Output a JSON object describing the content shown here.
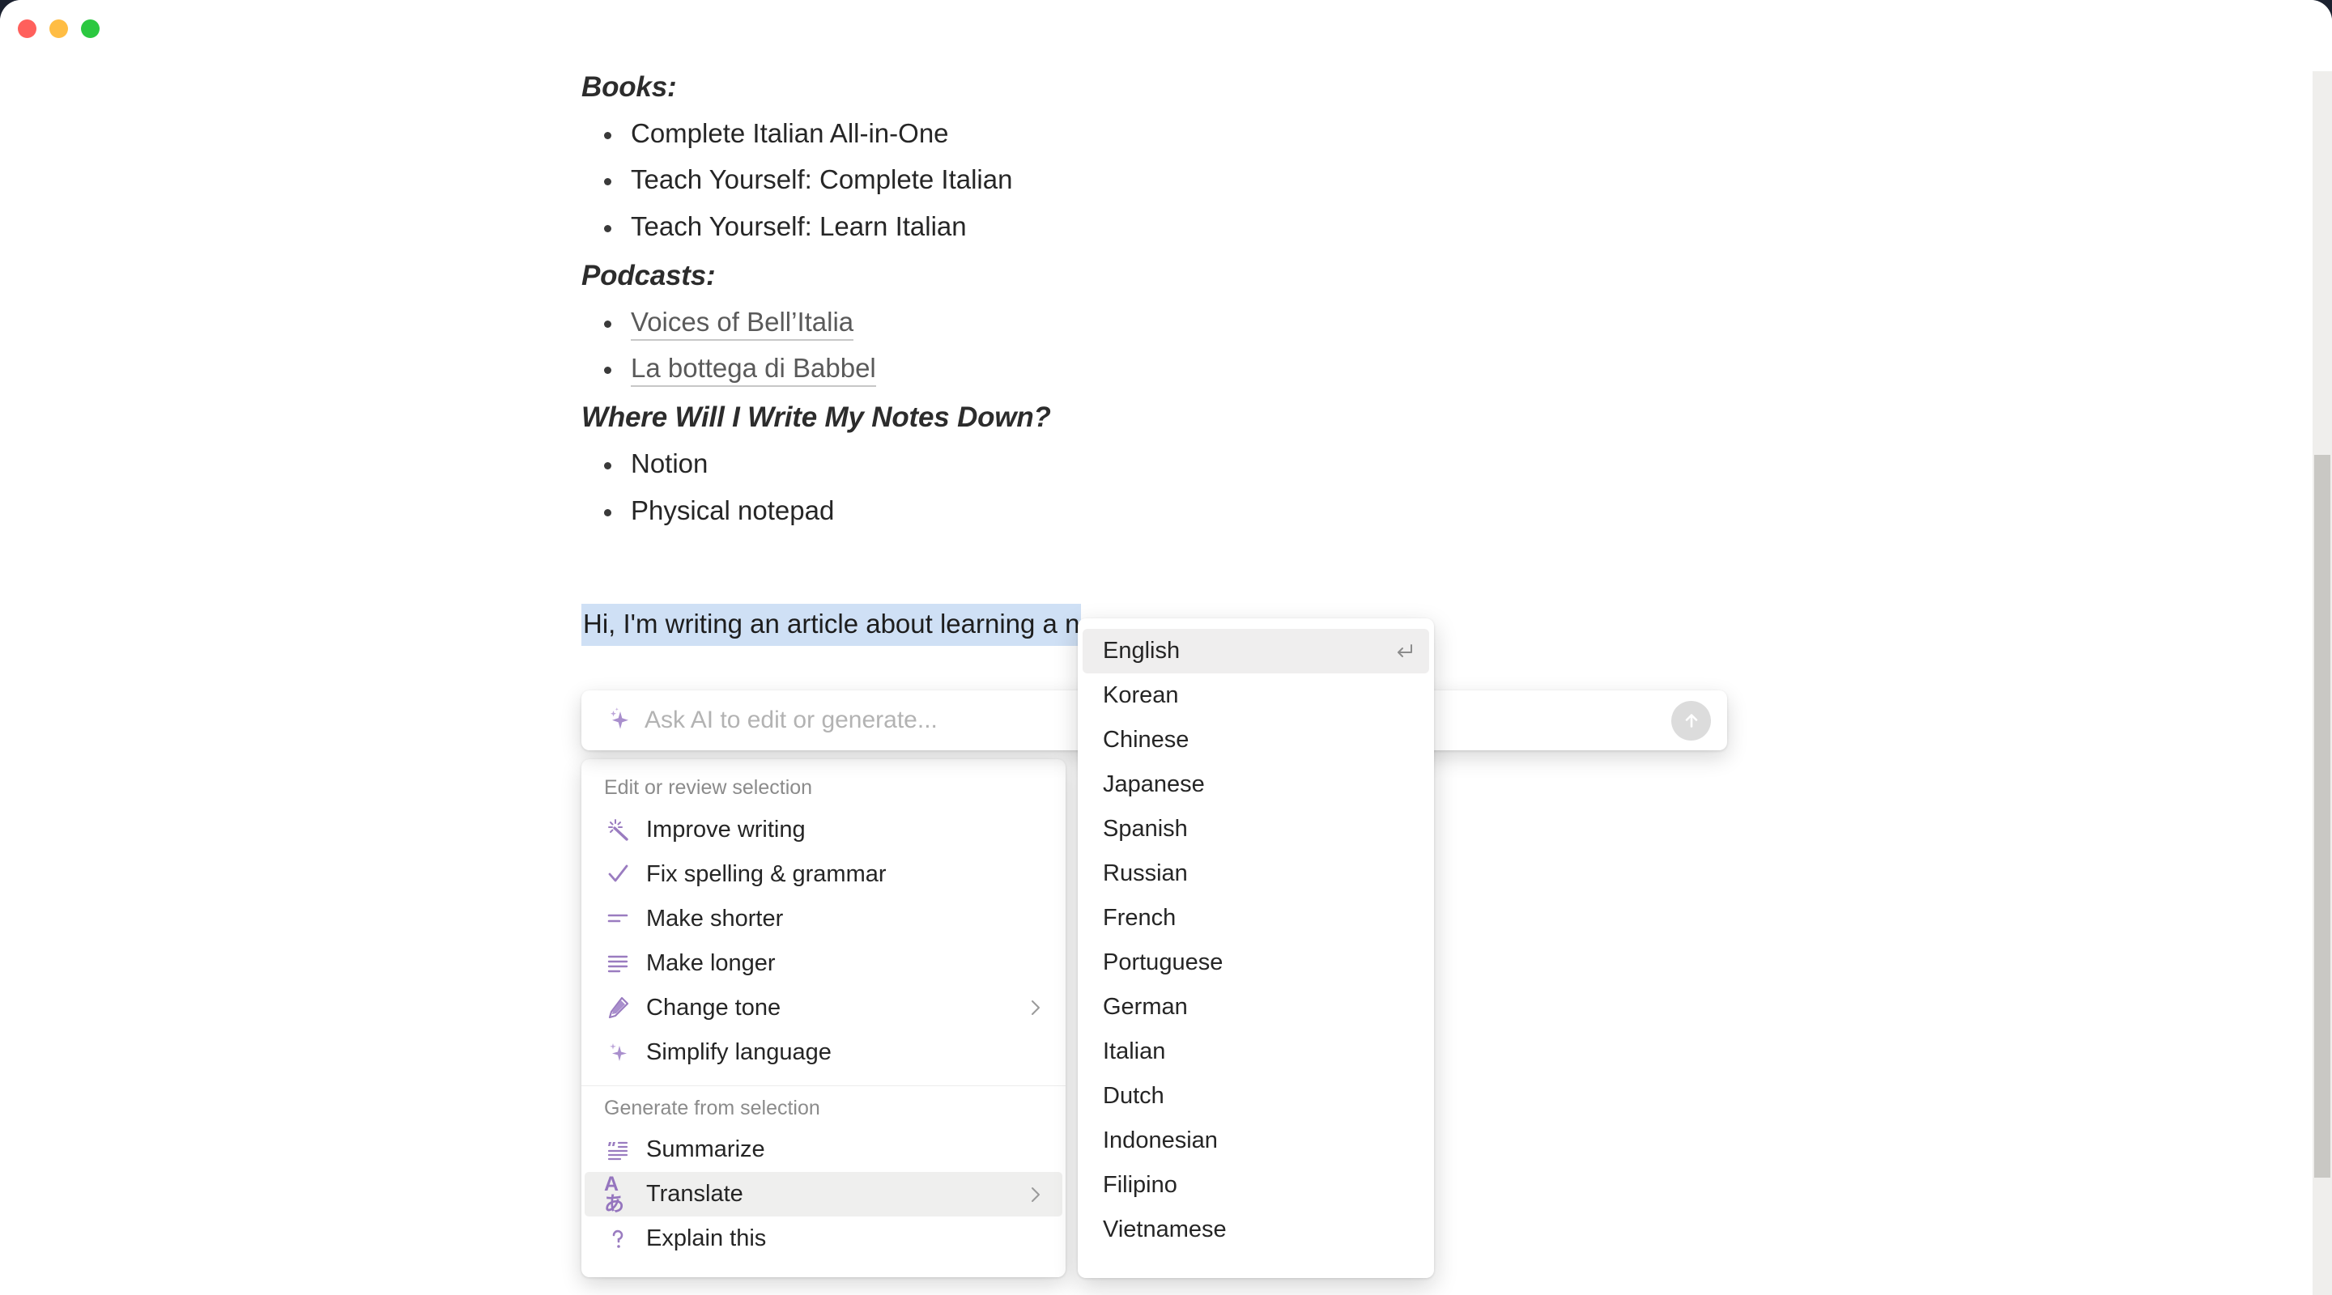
{
  "window": {
    "traffic_lights": [
      {
        "name": "close",
        "color": "#ff605c"
      },
      {
        "name": "minimize",
        "color": "#ffbd44"
      },
      {
        "name": "maximize",
        "color": "#2bc840"
      }
    ]
  },
  "document": {
    "sections": [
      {
        "heading": "Books:",
        "items": [
          {
            "text": "Complete Italian All-in-One",
            "link": false
          },
          {
            "text": "Teach Yourself: Complete Italian",
            "link": false
          },
          {
            "text": "Teach Yourself: Learn Italian",
            "link": false
          }
        ]
      },
      {
        "heading": "Podcasts:",
        "items": [
          {
            "text": "Voices of Bell’Italia",
            "link": true
          },
          {
            "text": "La bottega di Babbel",
            "link": true
          }
        ]
      },
      {
        "heading": "Where Will I Write My Notes Down?",
        "items": [
          {
            "text": "Notion",
            "link": false
          },
          {
            "text": "Physical notepad",
            "link": false
          }
        ]
      }
    ],
    "selected_paragraph": "Hi, I'm writing an article about learning a n",
    "selection_color": "#cfe0f5"
  },
  "ai_input": {
    "placeholder": "Ask AI to edit or generate...",
    "icon": "sparkle-icon",
    "submit_icon": "arrow-up-icon",
    "accent_color": "#9a7cc0"
  },
  "ai_menu": {
    "groups": [
      {
        "label": "Edit or review selection",
        "items": [
          {
            "label": "Improve writing",
            "icon": "magic-wand-icon",
            "submenu": false,
            "active": false
          },
          {
            "label": "Fix spelling & grammar",
            "icon": "check-icon",
            "submenu": false,
            "active": false
          },
          {
            "label": "Make shorter",
            "icon": "make-shorter-icon",
            "submenu": false,
            "active": false
          },
          {
            "label": "Make longer",
            "icon": "make-longer-icon",
            "submenu": false,
            "active": false
          },
          {
            "label": "Change tone",
            "icon": "pen-icon",
            "submenu": true,
            "active": false
          },
          {
            "label": "Simplify language",
            "icon": "sparkle-icon",
            "submenu": false,
            "active": false
          }
        ]
      },
      {
        "label": "Generate from selection",
        "items": [
          {
            "label": "Summarize",
            "icon": "quote-lines-icon",
            "submenu": false,
            "active": false
          },
          {
            "label": "Translate",
            "icon": "translate-icon",
            "glyph": "Aあ",
            "submenu": true,
            "active": true
          },
          {
            "label": "Explain this",
            "icon": "question-mark-icon",
            "submenu": false,
            "active": false
          }
        ]
      }
    ]
  },
  "language_menu": {
    "items": [
      {
        "label": "English",
        "active": true,
        "shortcut": "enter-icon"
      },
      {
        "label": "Korean",
        "active": false
      },
      {
        "label": "Chinese",
        "active": false
      },
      {
        "label": "Japanese",
        "active": false
      },
      {
        "label": "Spanish",
        "active": false
      },
      {
        "label": "Russian",
        "active": false
      },
      {
        "label": "French",
        "active": false
      },
      {
        "label": "Portuguese",
        "active": false
      },
      {
        "label": "German",
        "active": false
      },
      {
        "label": "Italian",
        "active": false
      },
      {
        "label": "Dutch",
        "active": false
      },
      {
        "label": "Indonesian",
        "active": false
      },
      {
        "label": "Filipino",
        "active": false
      },
      {
        "label": "Vietnamese",
        "active": false
      }
    ]
  }
}
